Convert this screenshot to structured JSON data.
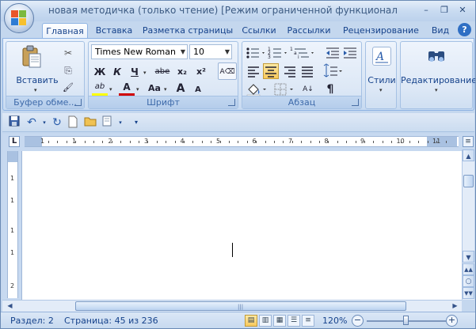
{
  "window": {
    "title": "новая методичка (только чтение) [Режим ограниченной функциональности] - Micro...",
    "controls": {
      "minimize": "–",
      "restore": "❐",
      "close": "✕"
    }
  },
  "tabs": [
    {
      "label": "Главная",
      "active": true
    },
    {
      "label": "Вставка"
    },
    {
      "label": "Разметка страницы"
    },
    {
      "label": "Ссылки"
    },
    {
      "label": "Рассылки"
    },
    {
      "label": "Рецензирование"
    },
    {
      "label": "Вид"
    }
  ],
  "help_label": "?",
  "ribbon": {
    "clipboard": {
      "label": "Буфер обме...",
      "paste_label": "Вставить",
      "paste_arrow": "▾",
      "cut_icon": "✂",
      "copy_icon": "⎘",
      "format_painter_icon": "🖌"
    },
    "font": {
      "label": "Шрифт",
      "font_name": "Times New Roman",
      "font_size": "10",
      "clear_format_icon": "A⌫",
      "bold": "Ж",
      "italic": "К",
      "underline": "Ч",
      "strike": "abe",
      "subscript": "x₂",
      "superscript": "x²",
      "highlight_label": "ab",
      "font_color_label": "A",
      "change_case": "Aa",
      "grow": "A",
      "shrink": "A"
    },
    "paragraph": {
      "label": "Абзац",
      "pilcrow": "¶",
      "sort_label": "А↓"
    },
    "styles": {
      "label": "Стили"
    },
    "editing": {
      "label": "Редактирование"
    }
  },
  "qat": {
    "customize_icon": "▾"
  },
  "ruler": {
    "corner": "L",
    "numbers": [
      "1",
      "1",
      "2",
      "3",
      "4",
      "5",
      "6",
      "7",
      "8",
      "9",
      "10",
      "11"
    ],
    "vnumbers": [
      "1",
      "1",
      "1",
      "1",
      "2"
    ]
  },
  "status": {
    "section": "Раздел: 2",
    "page": "Страница: 45 из 236",
    "zoom": "120%",
    "zoom_minus": "−",
    "zoom_plus": "+"
  },
  "colors": {
    "accent": "#15428b",
    "ribbon_bg": "#dde8f6",
    "highlight": "#ffff00",
    "font_color": "#d00000",
    "active_view": "#f8c95c"
  }
}
